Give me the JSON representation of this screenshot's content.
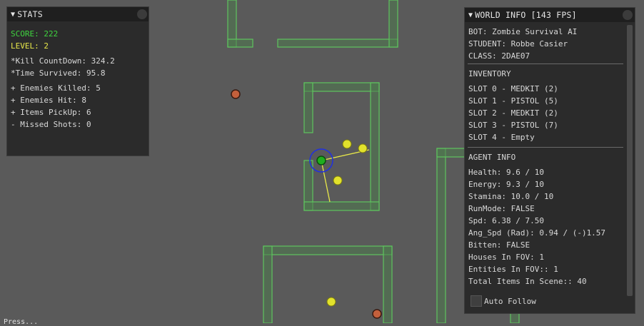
{
  "stats": {
    "title": "STATS",
    "score": "SCORE: 222",
    "level": "LEVEL: 2",
    "kill_countdown": "*Kill CountDown: 324.2",
    "time_survived": "*Time Survived: 95.8",
    "enemies_killed": "+ Enemies Killed: 5",
    "enemies_hit": "+ Enemies Hit: 8",
    "items_pickup": "+ Items PickUp: 6",
    "missed_shots": "- Missed Shots: 0",
    "colors": {
      "score": "#3fd43f",
      "level": "#e8e84a"
    }
  },
  "world_info": {
    "title": "WORLD INFO [143 FPS]",
    "bot": "BOT: Zombie Survival AI",
    "student": "STUDENT: Robbe Casier",
    "class": "CLASS: 2DAE07",
    "inventory_header": "INVENTORY",
    "inventory": [
      "SLOT 0 - MEDKIT (2)",
      "SLOT 1 - PISTOL (5)",
      "SLOT 2 - MEDKIT (2)",
      "SLOT 3 - PISTOL (7)",
      "SLOT 4 - Empty"
    ],
    "agent_header": "AGENT INFO",
    "agent": {
      "health": "Health: 9.6 / 10",
      "energy": "Energy: 9.3 / 10",
      "stamina": "Stamina: 10.0 / 10",
      "runmode": "RunMode: FALSE",
      "spd": "Spd: 6.38 / 7.50",
      "ang_spd": "Ang_Spd (Rad): 0.94 / (-)1.57",
      "bitten": "Bitten: FALSE",
      "houses_fov": "Houses In FOV: 1",
      "entities_fov": "Entities In FOV:: 1",
      "total_items": "Total Items In Scene:: 40"
    },
    "auto_follow_label": "Auto Follow",
    "auto_follow_checked": false
  },
  "bottom_text": "Press...",
  "colors": {
    "background": "#5a5a5a",
    "wall_stroke": "#5ec45e",
    "wall_fill": "#4f7a4f",
    "item": "#e2e22c",
    "agent": "#1fae1f",
    "agent_ring": "#2030e0",
    "fov_line": "#e8e84a",
    "enemy": "#c4603c"
  }
}
